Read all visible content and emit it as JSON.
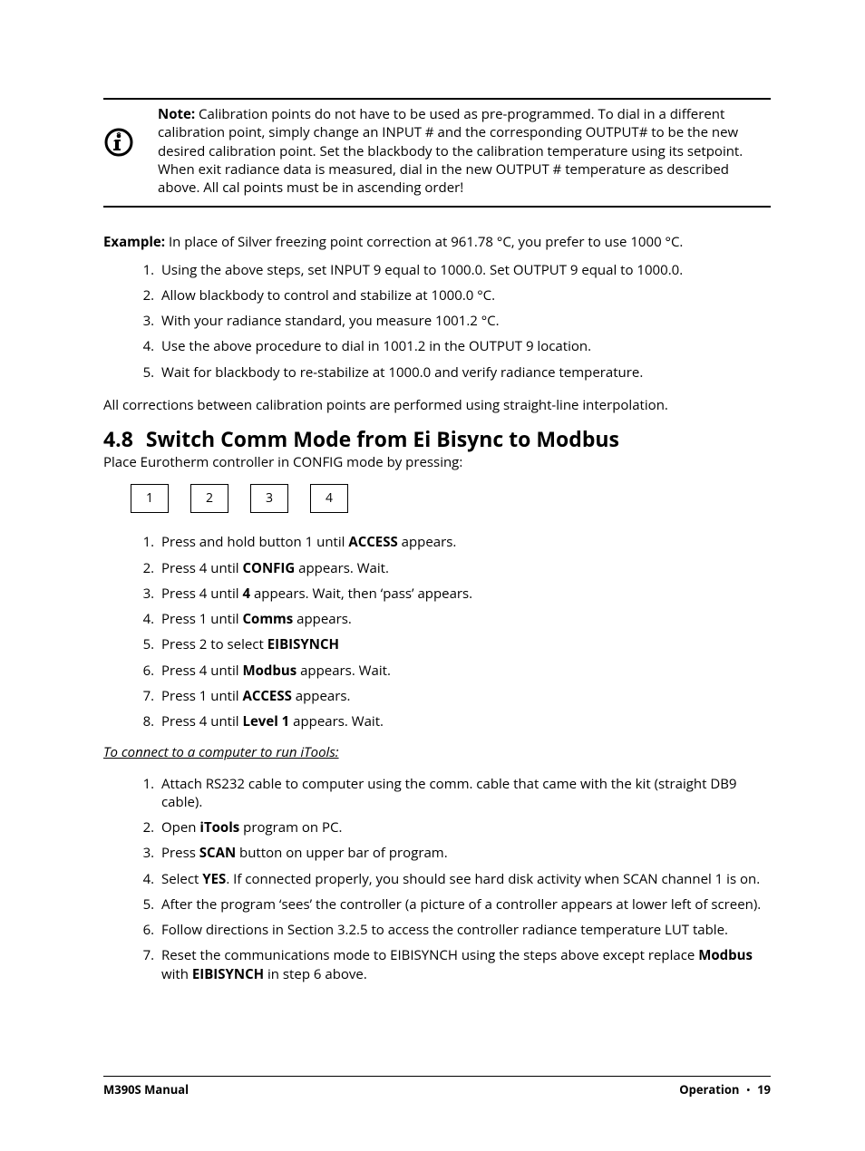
{
  "note": {
    "label": "Note:",
    "body": " Calibration points do not have to be used as pre-programmed. To dial in a different calibration point, simply change an INPUT # and the corresponding OUTPUT# to be the new desired calibration point. Set the blackbody to the calibration temperature using its setpoint. When exit radiance data is measured, dial in the new OUTPUT # temperature as described above. All cal points must be in ascending order!"
  },
  "example": {
    "label": "Example:",
    "body": "  In place of Silver freezing point correction at 961.78 °C, you prefer to use 1000 °C.",
    "steps": [
      "Using the above steps, set INPUT 9 equal  to 1000.0.  Set OUTPUT 9 equal to 1000.0.",
      "Allow blackbody to control and stabilize at 1000.0 °C.",
      "With your radiance standard, you measure 1001.2 °C.",
      "Use the above procedure to dial in 1001.2 in the OUTPUT 9 location.",
      "Wait for blackbody to re-stabilize at 1000.0 and verify radiance temperature."
    ]
  },
  "interp_line": "All corrections between calibration points are performed using straight-line interpolation.",
  "section": {
    "num": "4.8",
    "title": "Switch Comm Mode from Ei Bisync to Modbus",
    "intro": "Place Eurotherm controller in CONFIG mode by pressing:"
  },
  "buttons": [
    "1",
    "2",
    "3",
    "4"
  ],
  "config_steps": [
    {
      "pre": "Press and hold button 1 until ",
      "bold": "ACCESS",
      "post": " appears."
    },
    {
      "pre": "Press 4 until ",
      "bold": "CONFIG",
      "post": " appears. Wait."
    },
    {
      "pre": "Press 4 until ",
      "bold": "4",
      "post": " appears. Wait, then ‘pass’ appears."
    },
    {
      "pre": "Press 1 until ",
      "bold": "Comms",
      "post": " appears."
    },
    {
      "pre": "Press 2 to select ",
      "bold": "EIBISYNCH",
      "post": ""
    },
    {
      "pre": "Press 4 until ",
      "bold": "Modbus",
      "post": " appears. Wait."
    },
    {
      "pre": "Press 1 until ",
      "bold": "ACCESS",
      "post": " appears."
    },
    {
      "pre": "Press 4 until ",
      "bold": "Level 1",
      "post": " appears. Wait."
    }
  ],
  "itools_head": "To connect to a computer to run iTools:",
  "itools_steps": [
    {
      "pre": "Attach RS232 cable to computer using the comm. cable that came with the kit (straight DB9 cable).",
      "bold": "",
      "post": ""
    },
    {
      "pre": "Open ",
      "bold": "iTools",
      "post": " program on PC."
    },
    {
      "pre": "Press ",
      "bold": "SCAN",
      "post": " button on upper bar of program."
    },
    {
      "pre": "Select ",
      "bold": "YES",
      "post": ". If connected properly, you should see hard disk activity when SCAN channel 1 is on."
    },
    {
      "pre": "After the program ‘sees’ the controller (a picture of a controller appears at lower left of screen).",
      "bold": "",
      "post": ""
    },
    {
      "pre": "Follow directions in Section 3.2.5 to access the controller radiance temperature LUT table.",
      "bold": "",
      "post": ""
    },
    {
      "pre": "Reset the communications mode to EIBISYNCH using the steps above except replace ",
      "bold": "Modbus",
      "post": " with ",
      "bold2": "EIBISYNCH",
      "post2": " in step 6 above."
    }
  ],
  "footer": {
    "left": "M390S Manual",
    "right_label": "Operation",
    "page": "19"
  }
}
